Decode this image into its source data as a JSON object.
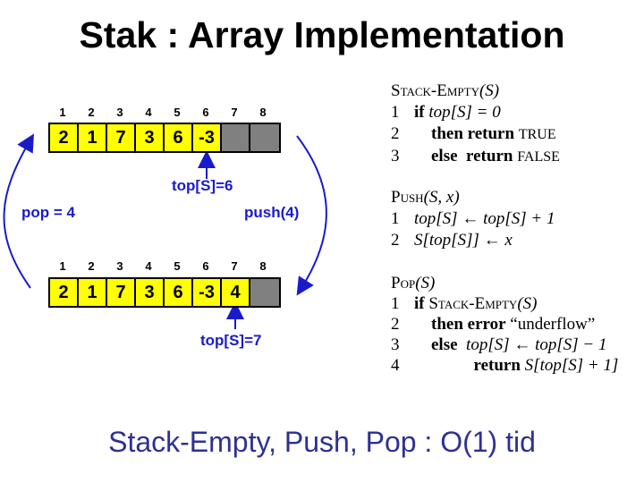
{
  "title": "Stak : Array Implementation",
  "footer": "Stack-Empty, Push, Pop : O(1) tid",
  "diagram": {
    "indices": [
      "1",
      "2",
      "3",
      "4",
      "5",
      "6",
      "7",
      "8"
    ],
    "before": {
      "cells": [
        "2",
        "1",
        "7",
        "3",
        "6",
        "-3",
        "",
        ""
      ],
      "filled": 6,
      "top_label": "top[S]=6"
    },
    "after": {
      "cells": [
        "2",
        "1",
        "7",
        "3",
        "6",
        "-3",
        "4",
        ""
      ],
      "filled": 7,
      "top_label": "top[S]=7"
    },
    "pop_label": "pop  = 4",
    "push_label": "push(4)",
    "colors": {
      "filled": "#ffff00",
      "empty": "#808080",
      "arrow": "#1a1acc"
    }
  },
  "pseudocode": {
    "stack_empty": {
      "header_name": "Stack-Empty",
      "header_args": "(S)",
      "lines": [
        {
          "n": "1",
          "kw": "if",
          "rest": "top[S] = 0"
        },
        {
          "n": "2",
          "kw": "then return",
          "rest": "TRUE"
        },
        {
          "n": "3",
          "kw": "else  return",
          "rest": "FALSE"
        }
      ]
    },
    "push": {
      "header_name": "Push",
      "header_args": "(S, x)",
      "lines": [
        {
          "n": "1",
          "rest": "top[S] ← top[S] + 1"
        },
        {
          "n": "2",
          "rest": "S[top[S]] ← x"
        }
      ]
    },
    "pop": {
      "header_name": "Pop",
      "header_args": "(S)",
      "lines": [
        {
          "n": "1",
          "kw": "if",
          "rest_sc": "Stack-Empty",
          "rest": "(S)"
        },
        {
          "n": "2",
          "kw": "then error",
          "rest": "“underflow”"
        },
        {
          "n": "3",
          "kw": "else",
          "rest": "top[S] ← top[S] − 1"
        },
        {
          "n": "4",
          "kw": "return",
          "rest": "S[top[S] + 1]"
        }
      ]
    }
  }
}
